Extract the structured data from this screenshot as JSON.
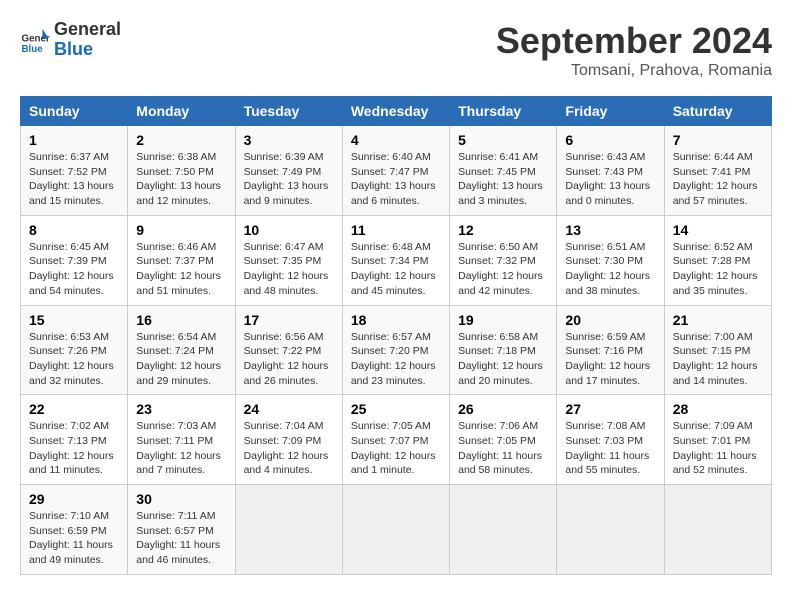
{
  "header": {
    "logo_line1": "General",
    "logo_line2": "Blue",
    "month": "September 2024",
    "location": "Tomsani, Prahova, Romania"
  },
  "weekdays": [
    "Sunday",
    "Monday",
    "Tuesday",
    "Wednesday",
    "Thursday",
    "Friday",
    "Saturday"
  ],
  "weeks": [
    [
      {
        "day": "1",
        "info": "Sunrise: 6:37 AM\nSunset: 7:52 PM\nDaylight: 13 hours\nand 15 minutes."
      },
      {
        "day": "2",
        "info": "Sunrise: 6:38 AM\nSunset: 7:50 PM\nDaylight: 13 hours\nand 12 minutes."
      },
      {
        "day": "3",
        "info": "Sunrise: 6:39 AM\nSunset: 7:49 PM\nDaylight: 13 hours\nand 9 minutes."
      },
      {
        "day": "4",
        "info": "Sunrise: 6:40 AM\nSunset: 7:47 PM\nDaylight: 13 hours\nand 6 minutes."
      },
      {
        "day": "5",
        "info": "Sunrise: 6:41 AM\nSunset: 7:45 PM\nDaylight: 13 hours\nand 3 minutes."
      },
      {
        "day": "6",
        "info": "Sunrise: 6:43 AM\nSunset: 7:43 PM\nDaylight: 13 hours\nand 0 minutes."
      },
      {
        "day": "7",
        "info": "Sunrise: 6:44 AM\nSunset: 7:41 PM\nDaylight: 12 hours\nand 57 minutes."
      }
    ],
    [
      {
        "day": "8",
        "info": "Sunrise: 6:45 AM\nSunset: 7:39 PM\nDaylight: 12 hours\nand 54 minutes."
      },
      {
        "day": "9",
        "info": "Sunrise: 6:46 AM\nSunset: 7:37 PM\nDaylight: 12 hours\nand 51 minutes."
      },
      {
        "day": "10",
        "info": "Sunrise: 6:47 AM\nSunset: 7:35 PM\nDaylight: 12 hours\nand 48 minutes."
      },
      {
        "day": "11",
        "info": "Sunrise: 6:48 AM\nSunset: 7:34 PM\nDaylight: 12 hours\nand 45 minutes."
      },
      {
        "day": "12",
        "info": "Sunrise: 6:50 AM\nSunset: 7:32 PM\nDaylight: 12 hours\nand 42 minutes."
      },
      {
        "day": "13",
        "info": "Sunrise: 6:51 AM\nSunset: 7:30 PM\nDaylight: 12 hours\nand 38 minutes."
      },
      {
        "day": "14",
        "info": "Sunrise: 6:52 AM\nSunset: 7:28 PM\nDaylight: 12 hours\nand 35 minutes."
      }
    ],
    [
      {
        "day": "15",
        "info": "Sunrise: 6:53 AM\nSunset: 7:26 PM\nDaylight: 12 hours\nand 32 minutes."
      },
      {
        "day": "16",
        "info": "Sunrise: 6:54 AM\nSunset: 7:24 PM\nDaylight: 12 hours\nand 29 minutes."
      },
      {
        "day": "17",
        "info": "Sunrise: 6:56 AM\nSunset: 7:22 PM\nDaylight: 12 hours\nand 26 minutes."
      },
      {
        "day": "18",
        "info": "Sunrise: 6:57 AM\nSunset: 7:20 PM\nDaylight: 12 hours\nand 23 minutes."
      },
      {
        "day": "19",
        "info": "Sunrise: 6:58 AM\nSunset: 7:18 PM\nDaylight: 12 hours\nand 20 minutes."
      },
      {
        "day": "20",
        "info": "Sunrise: 6:59 AM\nSunset: 7:16 PM\nDaylight: 12 hours\nand 17 minutes."
      },
      {
        "day": "21",
        "info": "Sunrise: 7:00 AM\nSunset: 7:15 PM\nDaylight: 12 hours\nand 14 minutes."
      }
    ],
    [
      {
        "day": "22",
        "info": "Sunrise: 7:02 AM\nSunset: 7:13 PM\nDaylight: 12 hours\nand 11 minutes."
      },
      {
        "day": "23",
        "info": "Sunrise: 7:03 AM\nSunset: 7:11 PM\nDaylight: 12 hours\nand 7 minutes."
      },
      {
        "day": "24",
        "info": "Sunrise: 7:04 AM\nSunset: 7:09 PM\nDaylight: 12 hours\nand 4 minutes."
      },
      {
        "day": "25",
        "info": "Sunrise: 7:05 AM\nSunset: 7:07 PM\nDaylight: 12 hours\nand 1 minute."
      },
      {
        "day": "26",
        "info": "Sunrise: 7:06 AM\nSunset: 7:05 PM\nDaylight: 11 hours\nand 58 minutes."
      },
      {
        "day": "27",
        "info": "Sunrise: 7:08 AM\nSunset: 7:03 PM\nDaylight: 11 hours\nand 55 minutes."
      },
      {
        "day": "28",
        "info": "Sunrise: 7:09 AM\nSunset: 7:01 PM\nDaylight: 11 hours\nand 52 minutes."
      }
    ],
    [
      {
        "day": "29",
        "info": "Sunrise: 7:10 AM\nSunset: 6:59 PM\nDaylight: 11 hours\nand 49 minutes."
      },
      {
        "day": "30",
        "info": "Sunrise: 7:11 AM\nSunset: 6:57 PM\nDaylight: 11 hours\nand 46 minutes."
      },
      {
        "day": "",
        "info": ""
      },
      {
        "day": "",
        "info": ""
      },
      {
        "day": "",
        "info": ""
      },
      {
        "day": "",
        "info": ""
      },
      {
        "day": "",
        "info": ""
      }
    ]
  ]
}
